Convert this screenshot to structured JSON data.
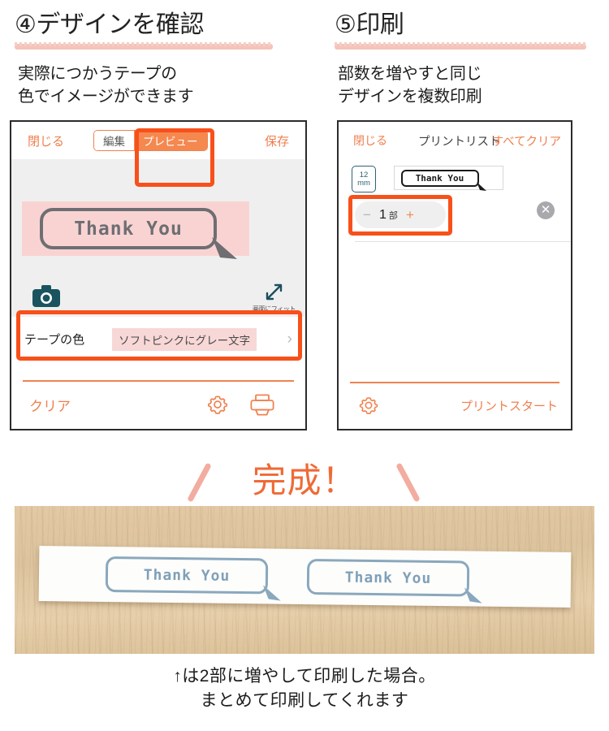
{
  "steps": [
    {
      "title": "④デザインを確認",
      "subtitle": "実際につかうテープの\n色でイメージができます"
    },
    {
      "title": "⑤印刷",
      "subtitle": "部数を増やすと同じ\nデザインを複数印刷"
    }
  ],
  "preview_screen": {
    "nav": {
      "close": "閉じる",
      "segment_edit": "編集",
      "segment_preview": "プレビュー",
      "save": "保存"
    },
    "tape_preview_text": "Thank You",
    "camera_icon": "camera-icon",
    "fit_icon": "expand-arrows-icon",
    "fit_caption": "画面にフィット",
    "tape_color_row": {
      "label": "テープの色",
      "value": "ソフトピンクにグレー文字",
      "chevron": "›"
    },
    "toolbar": {
      "clear": "クリア",
      "settings_icon": "gear-icon",
      "print_icon": "printer-icon"
    }
  },
  "print_screen": {
    "nav": {
      "close": "閉じる",
      "title": "プリントリスト",
      "clear_all": "すべてクリア"
    },
    "item": {
      "width_value": "12",
      "width_unit": "mm",
      "label_text": "Thank You",
      "copies_minus": "−",
      "copies_value": "1",
      "copies_unit": "部",
      "copies_plus": "+",
      "remove_icon": "close-circle-icon"
    },
    "toolbar": {
      "settings_icon": "gear-icon",
      "start": "プリントスタート"
    }
  },
  "done_banner": {
    "text": "完成！"
  },
  "photo": {
    "label_left": "Thank You",
    "label_right": "Thank You"
  },
  "caption": "↑は2部に増やして印刷した場合。\nまとめて印刷してくれます",
  "colors": {
    "accent_orange": "#ef7f4f",
    "highlight_red": "#f8501a",
    "rule_pink": "#f3b9ae",
    "tape_pink": "#f9d3d2",
    "bubble_gray": "#6e6e73",
    "bubble_blue": "#8aa8bd",
    "badge_teal": "#2f6274"
  }
}
